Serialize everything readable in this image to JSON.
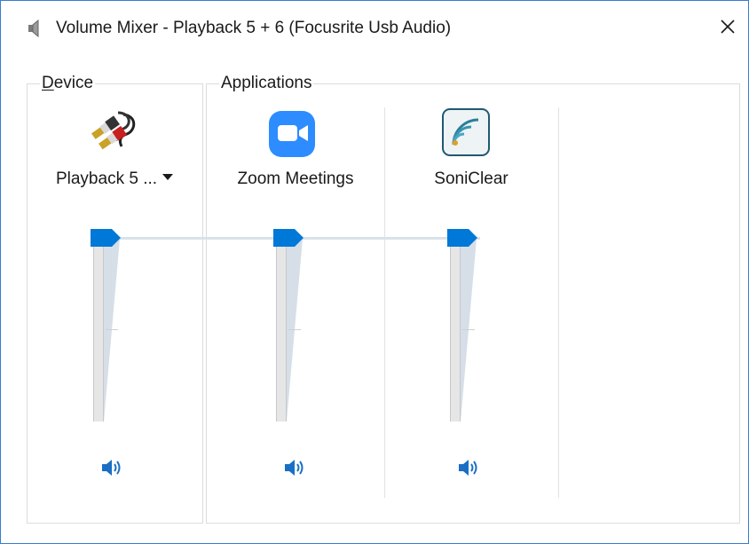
{
  "window": {
    "title": "Volume Mixer - Playback 5 + 6 (Focusrite Usb Audio)",
    "accent_color": "#0078d7",
    "title_icon": "speaker-icon",
    "close_icon": "close-icon"
  },
  "device_group": {
    "legend_underlined": "D",
    "legend_rest": "evice",
    "device": {
      "name": "Playback 5 ...",
      "icon": "rca-cable-icon",
      "volume_percent": 100,
      "mute_icon": "speaker-volume-icon"
    }
  },
  "applications_group": {
    "legend": "Applications",
    "apps": [
      {
        "name": "Zoom Meetings",
        "icon": "zoom-icon",
        "volume_percent": 100,
        "mute_icon": "speaker-volume-icon"
      },
      {
        "name": "SoniClear",
        "icon": "soniclear-icon",
        "volume_percent": 100,
        "mute_icon": "speaker-volume-icon"
      }
    ]
  }
}
